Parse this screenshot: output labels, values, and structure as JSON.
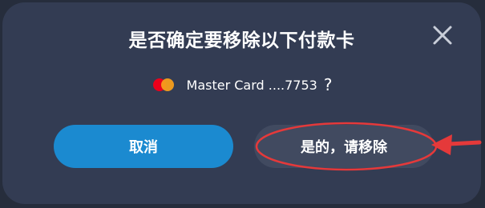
{
  "dialog": {
    "title": "是否确定要移除以下付款卡",
    "card_brand": "mastercard-icon",
    "card_text": "Master Card ....7753",
    "question_mark": "?",
    "cancel_label": "取消",
    "confirm_label": "是的，请移除"
  },
  "colors": {
    "backdrop": "#262d3c",
    "dialog_bg": "#333c53",
    "primary_button": "#1b8ad0",
    "secondary_button": "#414a60",
    "annotation_red": "#e5393a"
  }
}
